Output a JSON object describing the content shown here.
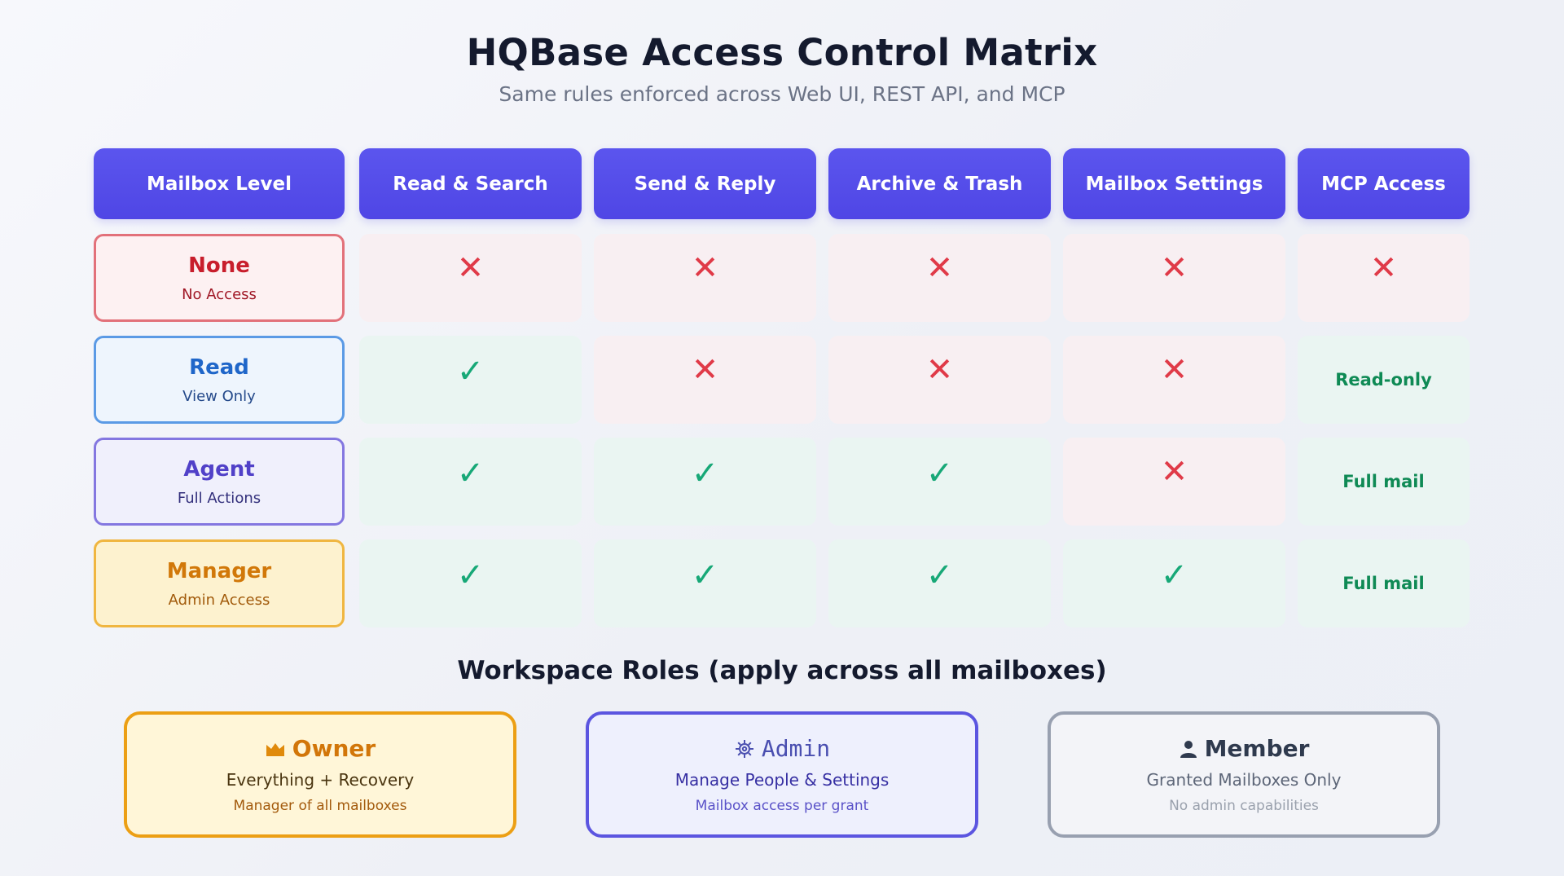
{
  "header": {
    "title": "HQBase Access Control Matrix",
    "subtitle": "Same rules enforced across Web UI, REST API, and MCP"
  },
  "matrix": {
    "columns": [
      "Mailbox Level",
      "Read & Search",
      "Send & Reply",
      "Archive & Trash",
      "Mailbox Settings",
      "MCP Access"
    ],
    "rows": [
      {
        "level": "None",
        "desc": "No Access",
        "cells": [
          "x",
          "x",
          "x",
          "x",
          "x"
        ]
      },
      {
        "level": "Read",
        "desc": "View Only",
        "cells": [
          "check",
          "x",
          "x",
          "x",
          "Read-only"
        ]
      },
      {
        "level": "Agent",
        "desc": "Full Actions",
        "cells": [
          "check",
          "check",
          "check",
          "x",
          "Full mail"
        ]
      },
      {
        "level": "Manager",
        "desc": "Admin Access",
        "cells": [
          "check",
          "check",
          "check",
          "check",
          "Full mail"
        ]
      }
    ]
  },
  "symbols": {
    "x": "✕",
    "check": "✓"
  },
  "roles_section": {
    "title": "Workspace Roles (apply across all mailboxes)",
    "roles": [
      {
        "icon": "crown-icon",
        "name": "Owner",
        "desc": "Everything + Recovery",
        "note": "Manager of all mailboxes"
      },
      {
        "icon": "gear-icon",
        "name": "Admin",
        "desc": "Manage People & Settings",
        "note": "Mailbox access per grant"
      },
      {
        "icon": "person-icon",
        "name": "Member",
        "desc": "Granted Mailboxes Only",
        "note": "No admin capabilities"
      }
    ]
  },
  "colors": {
    "header_bg": "#4f46e5",
    "deny": "#e03a48",
    "allow": "#17a877"
  }
}
